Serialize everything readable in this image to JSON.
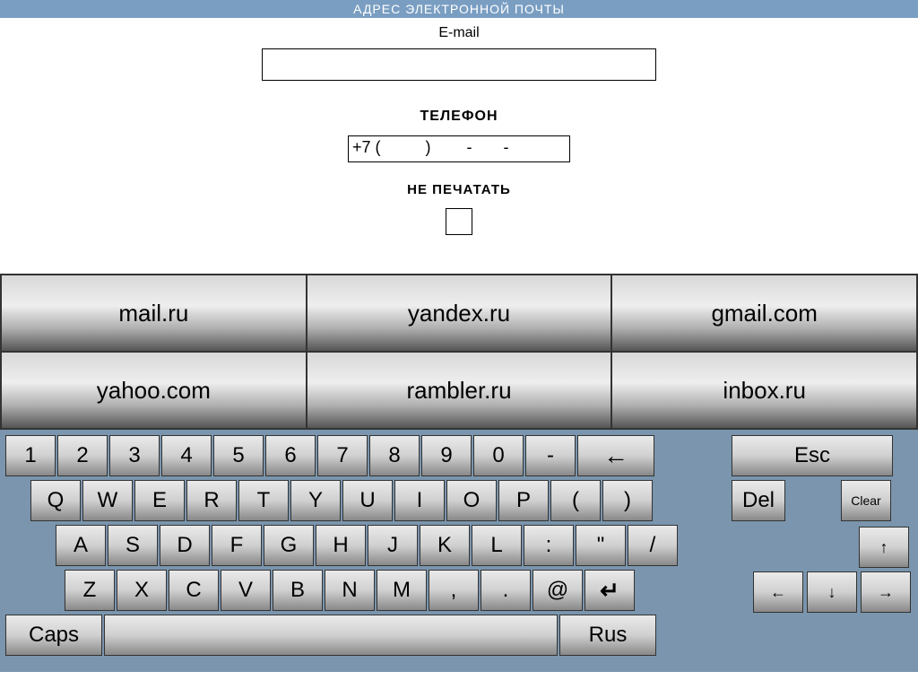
{
  "title_bar": "АДРЕС ЭЛЕКТРОННОЙ ПОЧТЫ",
  "form": {
    "email_label": "E-mail",
    "email_value": "",
    "phone_label": "ТЕЛЕФОН",
    "phone_value": "+7 (          )        -       -",
    "noprint_label": "НЕ ПЕЧАТАТЬ"
  },
  "shortcuts": [
    [
      "mail.ru",
      "yandex.ru",
      "gmail.com"
    ],
    [
      "yahoo.com",
      "rambler.ru",
      "inbox.ru"
    ]
  ],
  "keyboard": {
    "row1": [
      "1",
      "2",
      "3",
      "4",
      "5",
      "6",
      "7",
      "8",
      "9",
      "0",
      "-"
    ],
    "row2": [
      "Q",
      "W",
      "E",
      "R",
      "T",
      "Y",
      "U",
      "I",
      "O",
      "P",
      "(",
      ")"
    ],
    "row3": [
      "A",
      "S",
      "D",
      "F",
      "G",
      "H",
      "J",
      "K",
      "L",
      ":",
      "\"",
      "/"
    ],
    "row4": [
      "Z",
      "X",
      "C",
      "V",
      "B",
      "N",
      "M",
      ",",
      ".",
      "@"
    ],
    "backspace": "←",
    "enter": "↵",
    "caps": "Caps",
    "lang": "Rus",
    "esc": "Esc",
    "del": "Del",
    "clear": "Clear",
    "up": "↑",
    "down": "↓",
    "left": "←",
    "right": "→"
  }
}
